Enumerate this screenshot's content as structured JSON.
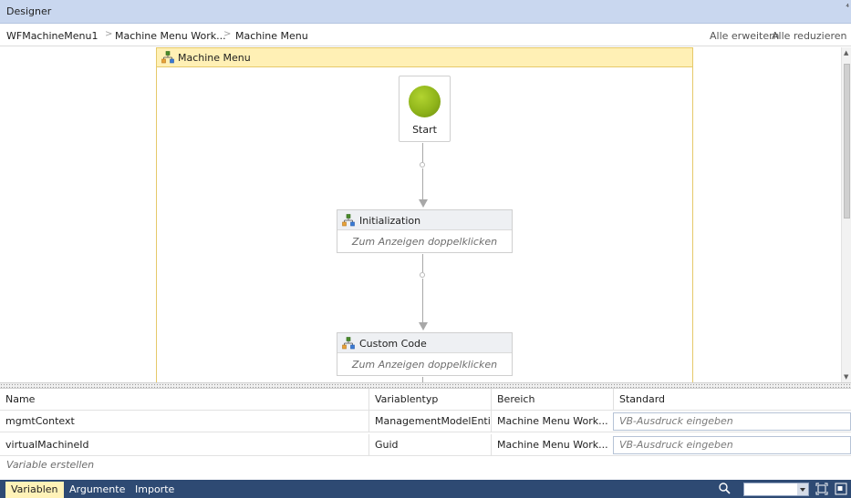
{
  "window": {
    "title": "Designer",
    "pin_glyph": "⁴"
  },
  "breadcrumb": {
    "items": [
      "WFMachineMenu1",
      "Machine Menu Work...",
      "Machine Menu"
    ],
    "separator": ">"
  },
  "toolbar": {
    "expand_all": "Alle erweitern",
    "collapse_all": "Alle reduzieren"
  },
  "flowchart": {
    "title": "Machine Menu",
    "start_label": "Start",
    "activities": [
      {
        "title": "Initialization",
        "hint": "Zum Anzeigen doppelklicken"
      },
      {
        "title": "Custom Code",
        "hint": "Zum Anzeigen doppelklicken"
      }
    ]
  },
  "variables": {
    "headers": [
      "Name",
      "Variablentyp",
      "Bereich",
      "Standard"
    ],
    "rows": [
      {
        "name": "mgmtContext",
        "type": "ManagementModelEntities",
        "scope": "Machine Menu Work...",
        "default_placeholder": "VB-Ausdruck eingeben"
      },
      {
        "name": "virtualMachineId",
        "type": "Guid",
        "scope": "Machine Menu Work...",
        "default_placeholder": "VB-Ausdruck eingeben"
      }
    ],
    "create_label": "Variable erstellen"
  },
  "bottom_tabs": [
    "Variablen",
    "Argumente",
    "Importe"
  ],
  "icons": {
    "flowchart": "flowchart-icon",
    "search": "search-icon",
    "fit": "fit-to-screen-icon",
    "overview": "overview-icon"
  },
  "colors": {
    "title_bar": "#c9d7ef",
    "flowchart_header": "#fff0b5",
    "flowchart_border": "#e6c96a",
    "start_green": "#8fb41a",
    "bottom_bar": "#2e4a73",
    "active_tab": "#fff2b8"
  }
}
